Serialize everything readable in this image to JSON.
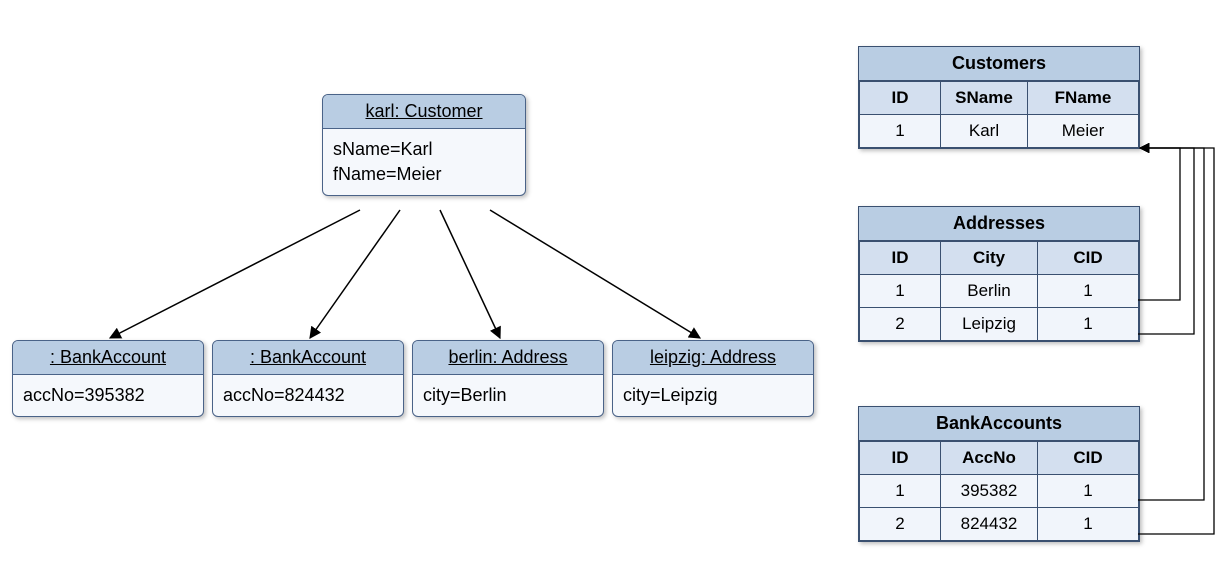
{
  "uml": {
    "customer": {
      "header": "karl: Customer",
      "attr1": "sName=Karl",
      "attr2": "fName=Meier"
    },
    "bank1": {
      "header": ": BankAccount",
      "attr": "accNo=395382"
    },
    "bank2": {
      "header": ": BankAccount",
      "attr": "accNo=824432"
    },
    "addr1": {
      "header": "berlin: Address",
      "attr": "city=Berlin"
    },
    "addr2": {
      "header": "leipzig: Address",
      "attr": "city=Leipzig"
    }
  },
  "tables": {
    "customers": {
      "title": "Customers",
      "cols": {
        "c0": "ID",
        "c1": "SName",
        "c2": "FName"
      },
      "rows": [
        {
          "c0": "1",
          "c1": "Karl",
          "c2": "Meier"
        }
      ]
    },
    "addresses": {
      "title": "Addresses",
      "cols": {
        "c0": "ID",
        "c1": "City",
        "c2": "CID"
      },
      "rows": [
        {
          "c0": "1",
          "c1": "Berlin",
          "c2": "1"
        },
        {
          "c0": "2",
          "c1": "Leipzig",
          "c2": "1"
        }
      ]
    },
    "bankaccounts": {
      "title": "BankAccounts",
      "cols": {
        "c0": "ID",
        "c1": "AccNo",
        "c2": "CID"
      },
      "rows": [
        {
          "c0": "1",
          "c1": "395382",
          "c2": "1"
        },
        {
          "c0": "2",
          "c1": "824432",
          "c2": "1"
        }
      ]
    }
  }
}
